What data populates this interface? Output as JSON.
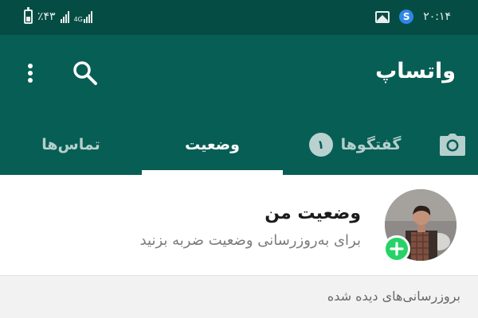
{
  "status_bar": {
    "battery_percent": "٪۴۳",
    "network_type": "4G",
    "time": "۲۰:۱۴",
    "icons": [
      "battery-icon",
      "signal-icon",
      "signal-4g-icon",
      "signal-icon",
      "gallery-icon",
      "s-app-icon"
    ]
  },
  "app_bar": {
    "title": "واتساپ",
    "icons": [
      "search-icon",
      "more-vert-icon"
    ]
  },
  "tabs": {
    "items": [
      {
        "icon": "camera-icon"
      },
      {
        "label": "گفتگوها",
        "badge": "۱"
      },
      {
        "label": "وضعیت",
        "active": true
      },
      {
        "label": "تماس‌ها"
      }
    ]
  },
  "my_status": {
    "title": "وضعیت من",
    "subtitle": "برای به‌روزرسانی وضعیت ضربه بزنید",
    "badge_icon": "add-icon"
  },
  "section_header": {
    "label": "بروزرسانی‌های دیده شده"
  },
  "colors": {
    "status_bar": "#054d44",
    "primary": "#075e54",
    "accent": "#25d366",
    "section_bg": "#f2f2f2"
  }
}
